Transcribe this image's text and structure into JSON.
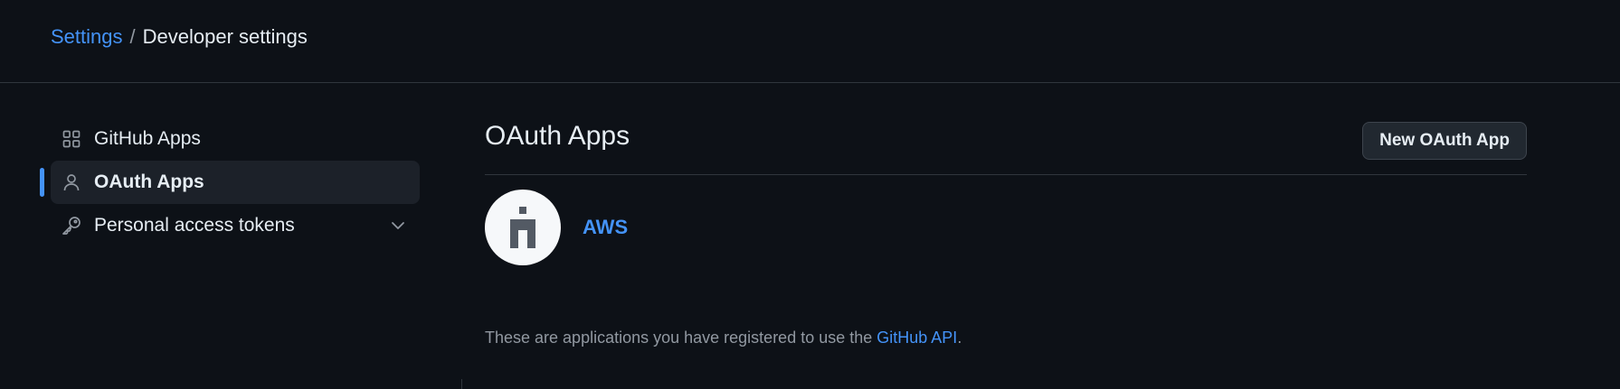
{
  "breadcrumb": {
    "parent": "Settings",
    "separator": "/",
    "current": "Developer settings"
  },
  "sidebar": {
    "items": [
      {
        "label": "GitHub Apps",
        "icon": "apps-icon",
        "active": false
      },
      {
        "label": "OAuth Apps",
        "icon": "person-icon",
        "active": true
      },
      {
        "label": "Personal access tokens",
        "icon": "key-icon",
        "active": false,
        "expandable": true
      }
    ]
  },
  "main": {
    "title": "OAuth Apps",
    "new_button_label": "New OAuth App",
    "apps": [
      {
        "name": "AWS",
        "avatar_icon": "default-app-icon"
      }
    ],
    "footnote": {
      "text": "These are applications you have registered to use the ",
      "link": "GitHub API",
      "suffix": "."
    }
  },
  "colors": {
    "background": "#0d1117",
    "border": "#30363d",
    "accent": "#4493f8",
    "text": "#e6edf3",
    "muted": "#9198a1"
  }
}
